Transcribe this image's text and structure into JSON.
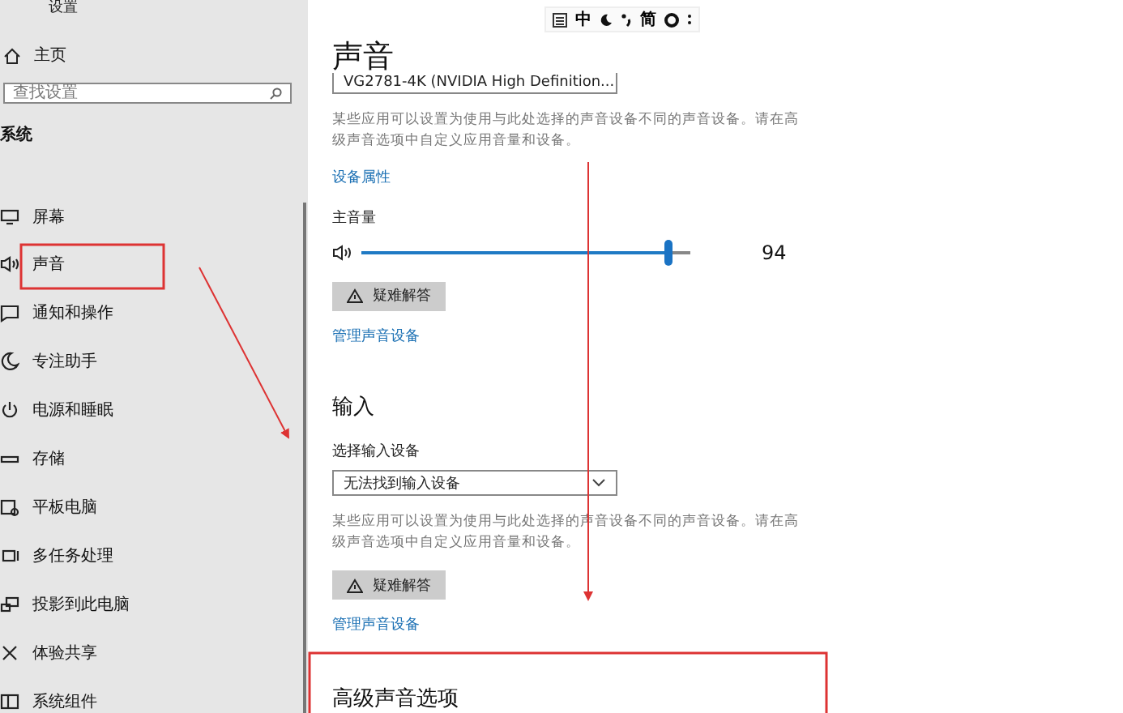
{
  "window": {
    "title": "设置"
  },
  "sidebar": {
    "home": "主页",
    "search": {
      "placeholder": "查找设置"
    },
    "section": "系统",
    "items": [
      {
        "label": "屏幕",
        "kind": "monitor"
      },
      {
        "label": "声音",
        "kind": "speaker"
      },
      {
        "label": "通知和操作",
        "kind": "message"
      },
      {
        "label": "专注助手",
        "kind": "moon"
      },
      {
        "label": "电源和睡眠",
        "kind": "power"
      },
      {
        "label": "存储",
        "kind": "drive"
      },
      {
        "label": "平板电脑",
        "kind": "tablet"
      },
      {
        "label": "多任务处理",
        "kind": "multitask"
      },
      {
        "label": "投影到此电脑",
        "kind": "project"
      },
      {
        "label": "体验共享",
        "kind": "share"
      },
      {
        "label": "系统组件",
        "kind": "components"
      }
    ]
  },
  "ime_bar": {
    "mode": "中",
    "script": "简"
  },
  "page": {
    "title": "声音",
    "output": {
      "device": "VG2781-4K (NVIDIA High Definition...",
      "description": "某些应用可以设置为使用与此处选择的声音设备不同的声音设备。请在高级声音选项中自定义应用音量和设备。",
      "properties_link": "设备属性",
      "volume_label": "主音量",
      "volume": {
        "level": 0.93,
        "reading": "94"
      },
      "troubleshoot": "疑难解答",
      "manage_link": "管理声音设备"
    },
    "input": {
      "heading": "输入",
      "select_label": "选择输入设备",
      "device": "无法找到输入设备",
      "description": "某些应用可以设置为使用与此处选择的声音设备不同的声音设备。请在高级声音选项中自定义应用音量和设备。",
      "troubleshoot": "疑难解答",
      "manage_link": "管理声音设备"
    },
    "advanced": {
      "heading": "高级声音选项"
    }
  }
}
